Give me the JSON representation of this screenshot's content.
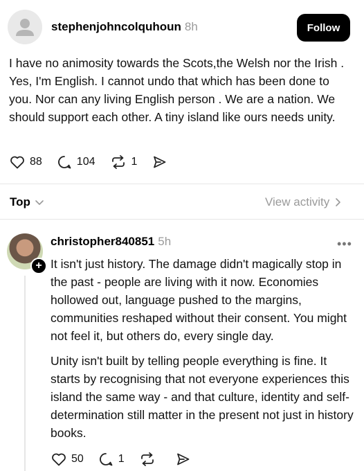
{
  "post": {
    "username": "stephenjohncolquhoun",
    "time": "8h",
    "follow_label": "Follow",
    "text": "I have no animosity towards  the Scots,the Welsh nor the Irish . Yes, I'm English. I cannot undo that which has been done to you. Nor can any living English person . We are a nation. We should support each other. A tiny island like ours needs unity.",
    "likes": "88",
    "replies": "104",
    "reposts": "1"
  },
  "replies_bar": {
    "sort_label": "Top",
    "view_activity": "View activity"
  },
  "reply": {
    "username": "christopher840851",
    "time": "5h",
    "more": "•••",
    "paragraph1": "It isn't just history. The damage didn't magically stop in the past - people are living with it now. Economies hollowed out, language pushed to the margins, communities reshaped without their consent. You might not feel it, but others do, every single day.",
    "paragraph2": "Unity isn't built by telling people everything is fine. It starts by recognising that not everyone experiences this island the same way - and that culture, identity and self-determination still matter in the present not just in history books.",
    "likes": "50",
    "replies": "1",
    "plus": "+"
  },
  "icons": {
    "like": "heart-icon",
    "reply": "comment-icon",
    "repost": "repost-icon",
    "share": "send-icon",
    "chevron": "chevron-icon"
  }
}
